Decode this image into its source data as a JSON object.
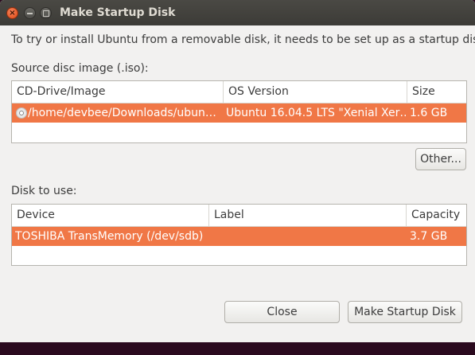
{
  "window": {
    "title": "Make Startup Disk",
    "intro": "To try or install Ubuntu from a removable disk, it needs to be set up as a startup disk."
  },
  "source": {
    "label": "Source disc image (.iso):",
    "columns": [
      "CD-Drive/Image",
      "OS Version",
      "Size"
    ],
    "rows": [
      {
        "image": "/home/devbee/Downloads/ubun…",
        "os_version": "Ubuntu 16.04.5 LTS \"Xenial Xer…",
        "size": "1.6 GB",
        "icon": "cd-icon",
        "selected": true
      }
    ],
    "other_button": "Other..."
  },
  "disk": {
    "label": "Disk to use:",
    "columns": [
      "Device",
      "Label",
      "Capacity"
    ],
    "rows": [
      {
        "device": "TOSHIBA TransMemory (/dev/sdb)",
        "label": "",
        "capacity": "3.7 GB",
        "selected": true
      }
    ]
  },
  "buttons": {
    "close": "Close",
    "make": "Make Startup Disk"
  },
  "colors": {
    "selection": "#f07746",
    "titlebar": "#3c3b37",
    "close_button": "#df4a16"
  }
}
